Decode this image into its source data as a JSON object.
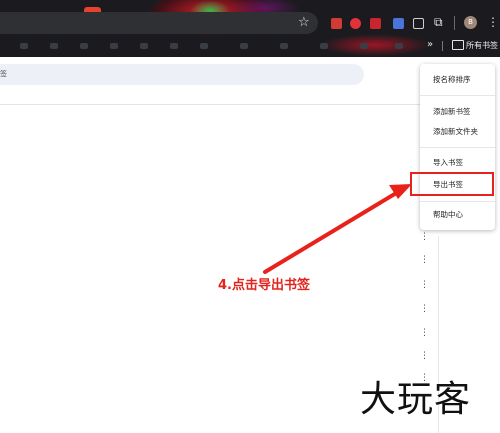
{
  "browser": {
    "toolbar_icons": [
      "bookmark-star-icon",
      "extension-icon",
      "extensions-puzzle-icon",
      "profile-avatar-icon",
      "more-menu-icon"
    ],
    "avatar_letter": "B",
    "all_bookmarks_label": "所有书签",
    "overflow_chevron": "»"
  },
  "search": {
    "placeholder_fragment": "签"
  },
  "menu": {
    "items": [
      {
        "label": "按名称排序"
      },
      {
        "label": "添加新书签"
      },
      {
        "label": "添加新文件夹"
      },
      {
        "label": "导入书签"
      },
      {
        "label": "导出书签"
      },
      {
        "label": "帮助中心"
      }
    ],
    "highlighted_item": "导出书签"
  },
  "annotation": {
    "text": "4.点击导出书签"
  },
  "watermark": {
    "text": "大玩客"
  },
  "colors": {
    "highlight": "#e8211b",
    "toolbar_bg": "#1b1b1f",
    "search_bg": "#edf1f7"
  }
}
